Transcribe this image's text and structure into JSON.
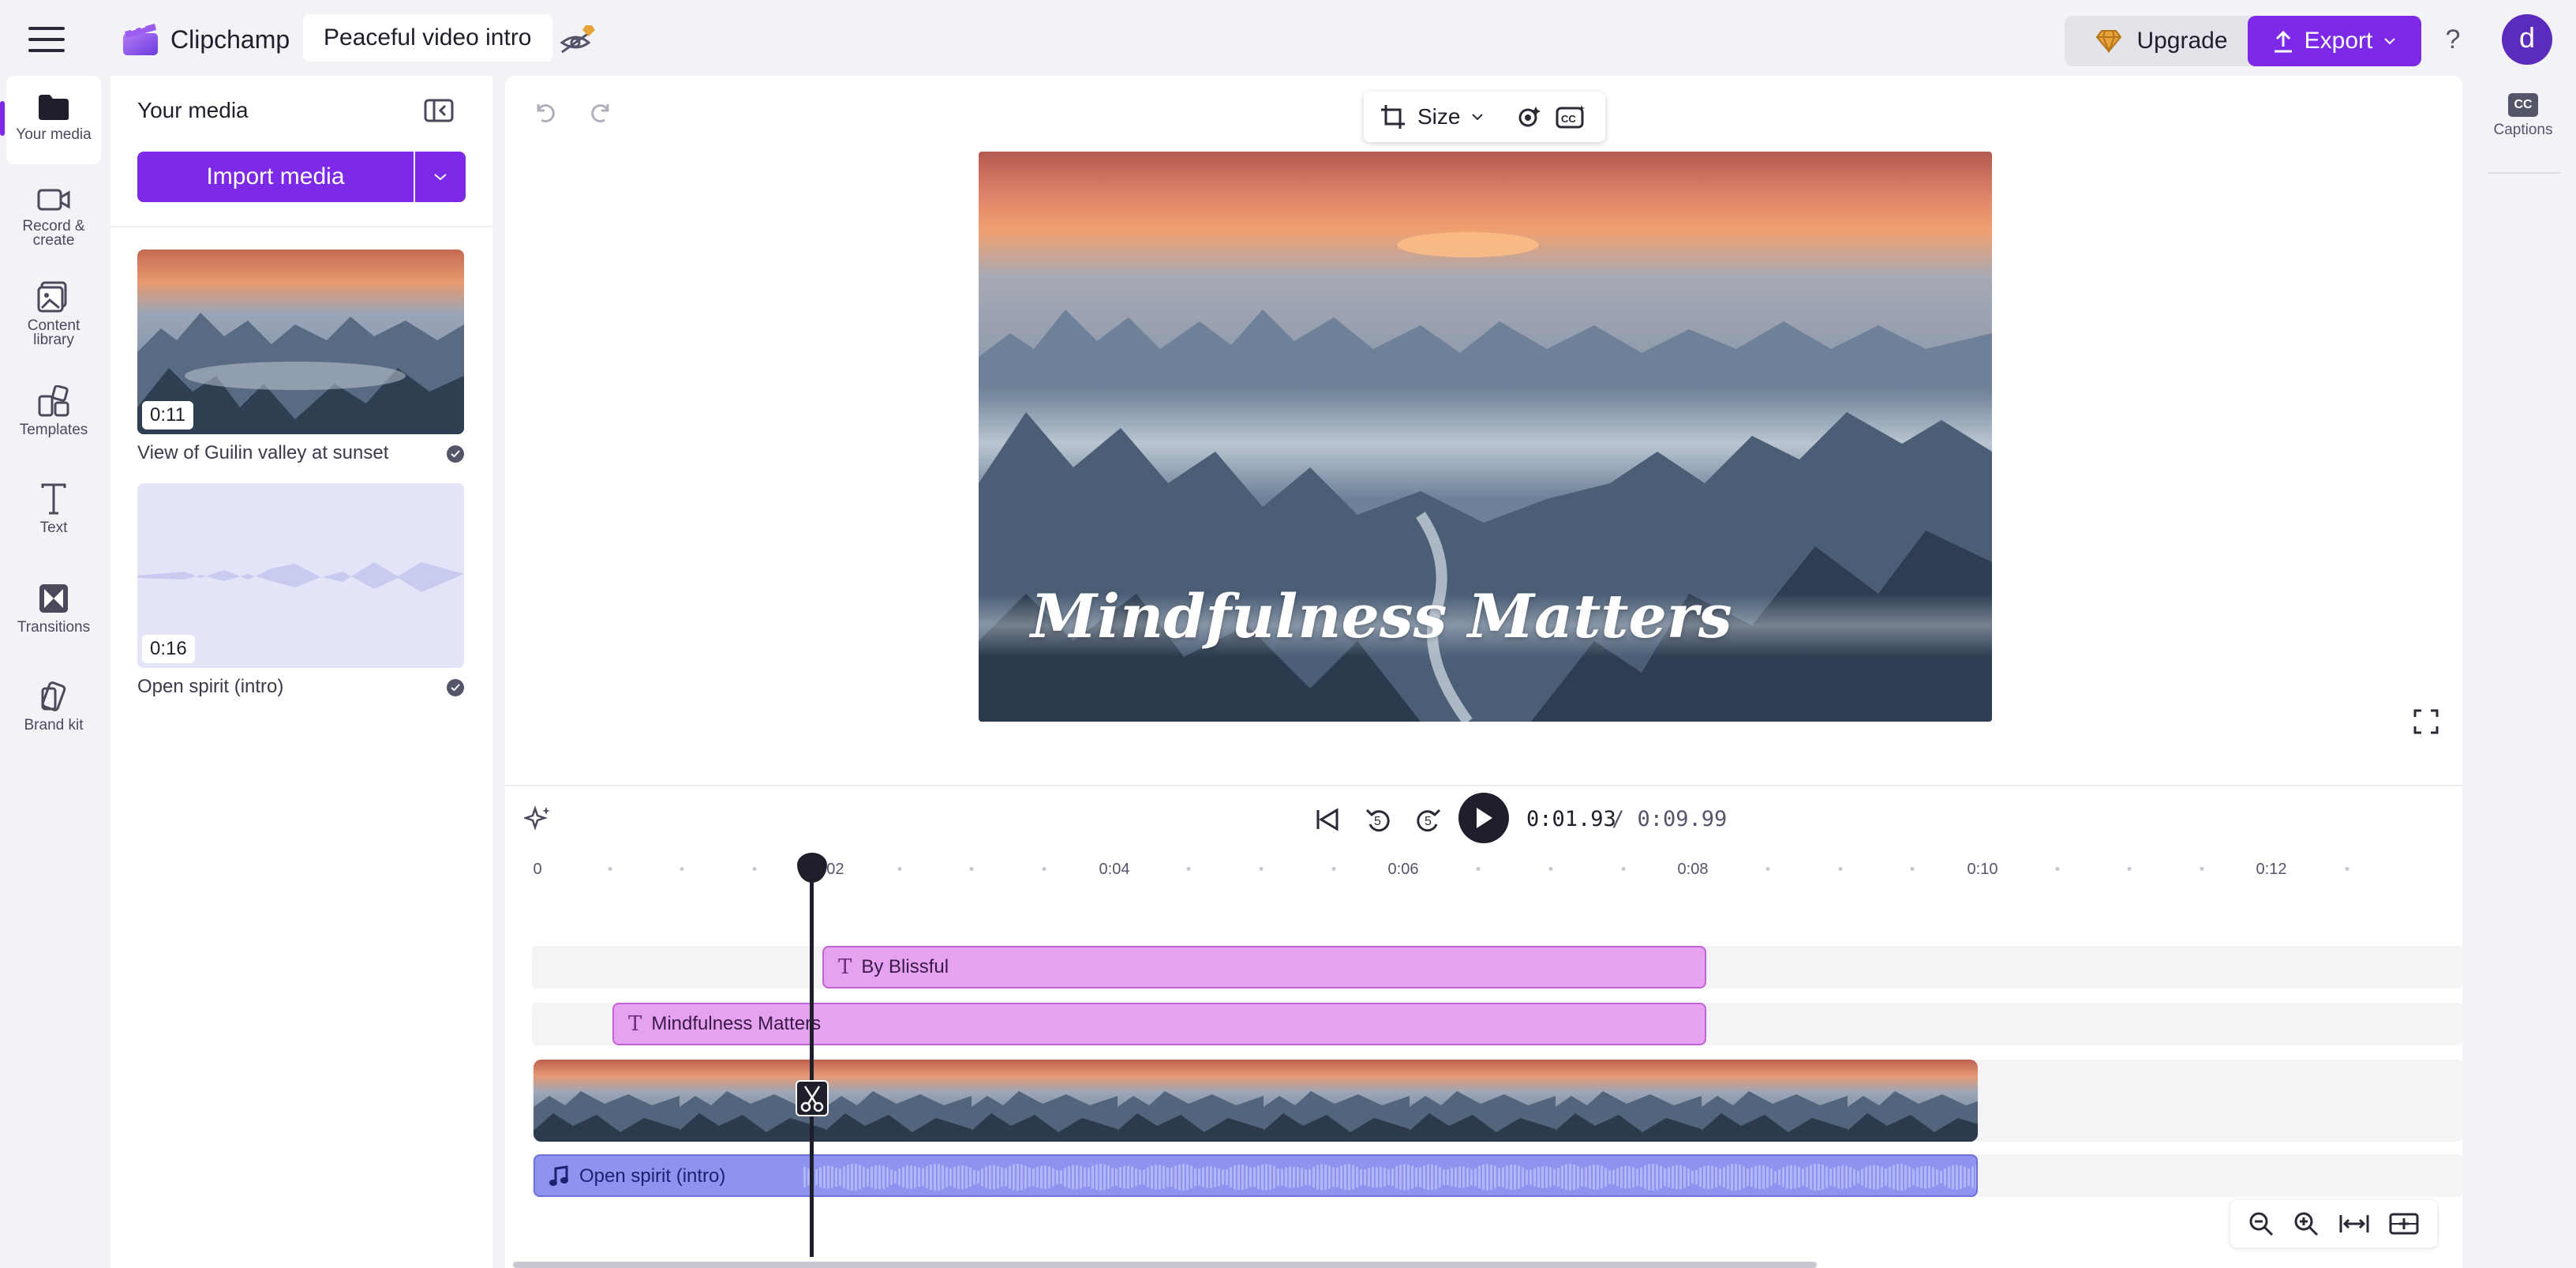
{
  "app": {
    "name": "Clipchamp",
    "project_title": "Peaceful video intro",
    "upgrade_label": "Upgrade",
    "export_label": "Export",
    "help_label": "?",
    "avatar_initial": "d",
    "accent_color": "#7d2ae8"
  },
  "nav": {
    "items": [
      {
        "label": "Your media",
        "icon": "folder-icon"
      },
      {
        "label": "Record & create",
        "icon": "camera-icon"
      },
      {
        "label": "Content library",
        "icon": "library-icon"
      },
      {
        "label": "Templates",
        "icon": "templates-icon"
      },
      {
        "label": "Text",
        "icon": "text-icon"
      },
      {
        "label": "Transitions",
        "icon": "transitions-icon"
      },
      {
        "label": "Brand kit",
        "icon": "brand-kit-icon"
      }
    ]
  },
  "media_panel": {
    "title": "Your media",
    "import_label": "Import media",
    "items": [
      {
        "name": "View of Guilin valley at sunset",
        "duration": "0:11"
      },
      {
        "name": "Open spirit (intro)",
        "duration": "0:16"
      }
    ]
  },
  "toolbar": {
    "size_label": "Size"
  },
  "preview": {
    "overlay_text": "Mindfulness Matters"
  },
  "playback": {
    "current_time": "0:01.93",
    "total_time": "/ 0:09.99",
    "skip_back_label": "5",
    "skip_fwd_label": "5"
  },
  "ruler": {
    "labels": [
      "0",
      "0:02",
      "0:04",
      "0:06",
      "0:08",
      "0:10",
      "0:12"
    ]
  },
  "tracks": {
    "text_clip_1": "By Blissful",
    "text_clip_2": "Mindfulness Matters",
    "audio_clip": "Open spirit (intro)"
  },
  "right_panel": {
    "captions_label": "Captions",
    "cc": "CC"
  }
}
